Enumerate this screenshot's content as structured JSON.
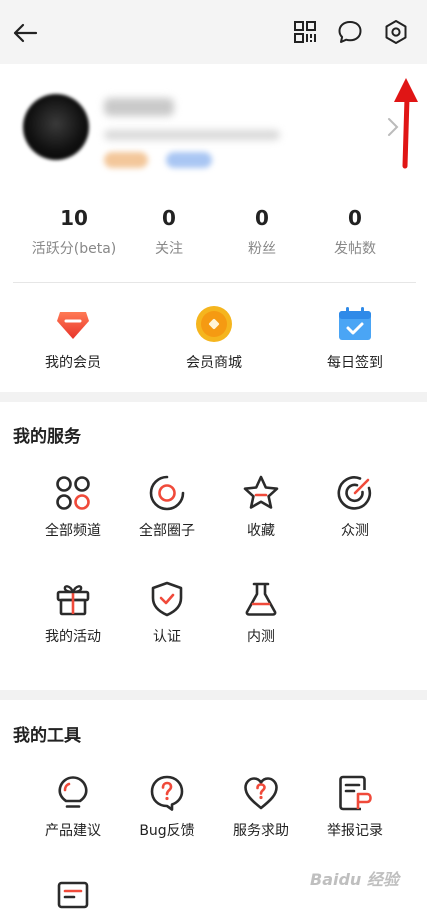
{
  "stats": [
    {
      "value": "10",
      "label": "活跃分(beta)"
    },
    {
      "value": "0",
      "label": "关注"
    },
    {
      "value": "0",
      "label": "粉丝"
    },
    {
      "value": "0",
      "label": "发帖数"
    }
  ],
  "quick_actions": [
    {
      "label": "我的会员",
      "icon": "vip-gem-icon"
    },
    {
      "label": "会员商城",
      "icon": "coin-icon"
    },
    {
      "label": "每日签到",
      "icon": "calendar-check-icon"
    }
  ],
  "services": {
    "title": "我的服务",
    "items": [
      {
        "label": "全部频道",
        "icon": "channels-icon"
      },
      {
        "label": "全部圈子",
        "icon": "circle-icon"
      },
      {
        "label": "收藏",
        "icon": "star-icon"
      },
      {
        "label": "众测",
        "icon": "target-icon"
      },
      {
        "label": "我的活动",
        "icon": "gift-icon"
      },
      {
        "label": "认证",
        "icon": "shield-check-icon"
      },
      {
        "label": "内测",
        "icon": "flask-icon"
      }
    ]
  },
  "tools": {
    "title": "我的工具",
    "items": [
      {
        "label": "产品建议",
        "icon": "lightbulb-icon"
      },
      {
        "label": "Bug反馈",
        "icon": "bug-feedback-icon"
      },
      {
        "label": "服务求助",
        "icon": "heart-help-icon"
      },
      {
        "label": "举报记录",
        "icon": "report-icon"
      },
      {
        "label": "",
        "icon": "inbox-icon"
      }
    ]
  },
  "watermark": "Baidu 经验",
  "colors": {
    "accent": "#f04a3a",
    "icon_dark": "#2b2b2b",
    "background": "#f2f2f2",
    "annotation": "#e01515"
  }
}
